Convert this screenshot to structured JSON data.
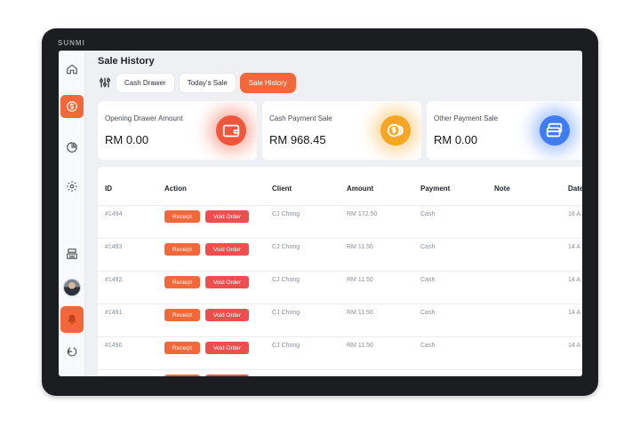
{
  "device": {
    "brand": "SUNMI"
  },
  "sidebar": {
    "items": [
      {
        "icon": "home-icon",
        "active": false
      },
      {
        "icon": "dollar-icon",
        "active": true
      },
      {
        "icon": "pie-chart-icon",
        "active": false
      },
      {
        "icon": "gear-icon",
        "active": false
      },
      {
        "icon": "cash-register-icon",
        "active": false
      },
      {
        "icon": "avatar",
        "active": false
      },
      {
        "icon": "bell-icon",
        "active": true
      },
      {
        "icon": "logout-icon",
        "active": false
      }
    ]
  },
  "header": {
    "title": "Sale History"
  },
  "tabs": [
    {
      "label": "Cash Drawer",
      "active": false
    },
    {
      "label": "Today's Sale",
      "active": false
    },
    {
      "label": "Sale History",
      "active": true
    }
  ],
  "cards": [
    {
      "label": "Opening Drawer Amount",
      "value": "RM 0.00",
      "icon": "wallet-icon",
      "color": "#f0563b"
    },
    {
      "label": "Cash Payment Sale",
      "value": "RM 968.45",
      "icon": "coins-icon",
      "color": "#f5a623"
    },
    {
      "label": "Other Payment Sale",
      "value": "RM 0.00",
      "icon": "cards-icon",
      "color": "#3f7cf4"
    }
  ],
  "table": {
    "headers": [
      "ID",
      "Action",
      "Client",
      "Amount",
      "Payment",
      "Note",
      "Date"
    ],
    "receipt_label": "Receipt",
    "void_label": "Void Order",
    "rows": [
      {
        "id": "#1494",
        "client": "CJ Chong",
        "amount": "RM 172.50",
        "payment": "Cash",
        "date": "16 A"
      },
      {
        "id": "#1493",
        "client": "CJ Chong",
        "amount": "RM 11.50",
        "payment": "Cash",
        "date": "14 A"
      },
      {
        "id": "#1492",
        "client": "CJ Chong",
        "amount": "RM 11.50",
        "payment": "Cash",
        "date": "14 A"
      },
      {
        "id": "#1491",
        "client": "CJ Chong",
        "amount": "RM 11.50",
        "payment": "Cash",
        "date": "14 A"
      },
      {
        "id": "#1490",
        "client": "CJ Chong",
        "amount": "RM 11.50",
        "payment": "Cash",
        "date": "14 A"
      }
    ]
  },
  "colors": {
    "accent": "#f2683a",
    "danger": "#ef4e4e",
    "background": "#eef0f4"
  }
}
